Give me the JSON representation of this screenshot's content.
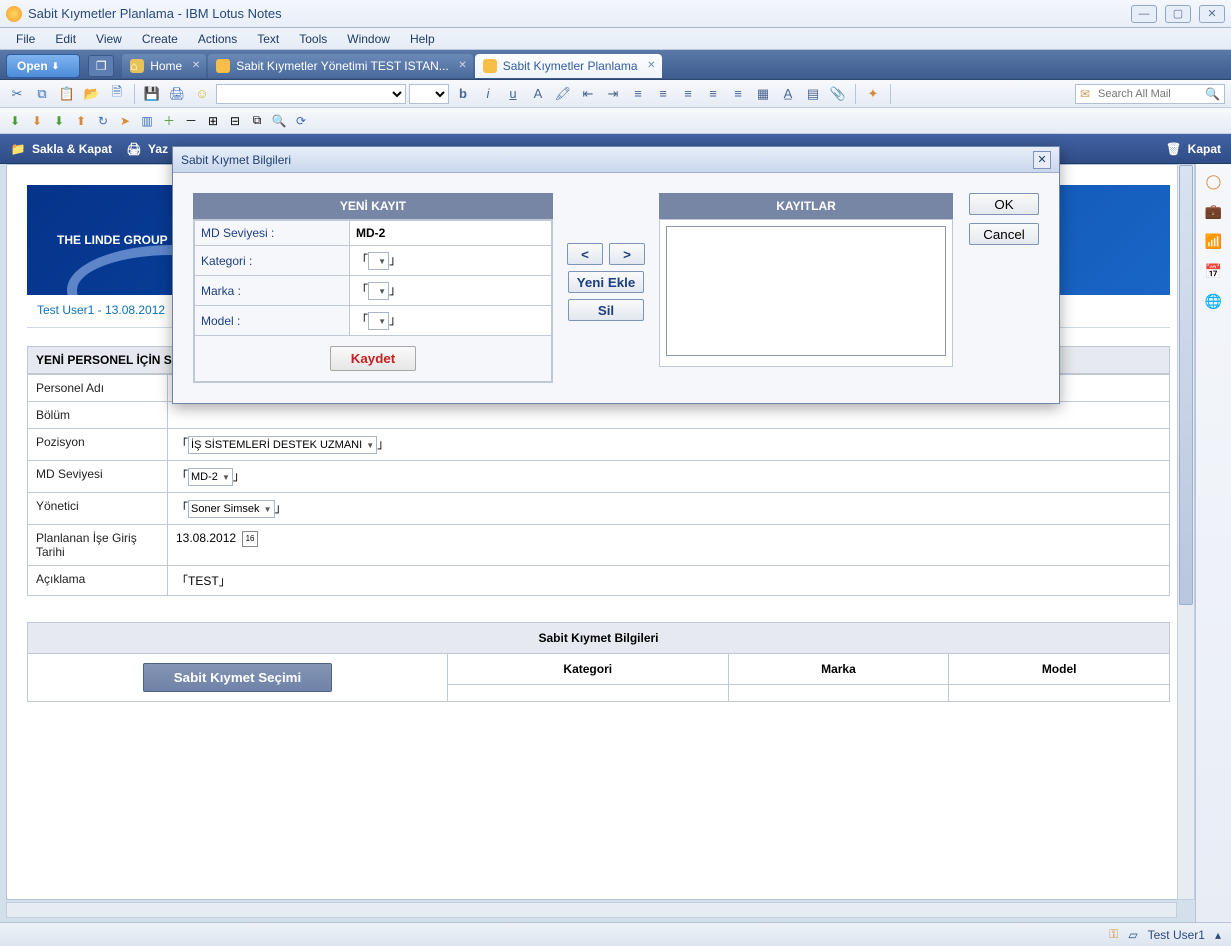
{
  "window": {
    "title": "Sabit Kıymetler Planlama - IBM Lotus Notes"
  },
  "menu": [
    "File",
    "Edit",
    "View",
    "Create",
    "Actions",
    "Text",
    "Tools",
    "Window",
    "Help"
  ],
  "open_button": "Open",
  "tabs": [
    {
      "label": "Home",
      "active": false
    },
    {
      "label": "Sabit Kıymetler Yönetimi TEST ISTAN...",
      "active": false
    },
    {
      "label": "Sabit Kıymetler Planlama",
      "active": true
    }
  ],
  "search_placeholder": "Search All Mail",
  "actions": {
    "save_close": "Sakla & Kapat",
    "print": "Yaz",
    "kapat": "Kapat"
  },
  "banner": {
    "company": "THE LINDE GROUP"
  },
  "info_line": "Test User1 - 13.08.2012",
  "form_section_title": "YENİ PERSONEL İÇİN SA",
  "form_rows": {
    "personel_adi": {
      "label": "Personel Adı",
      "value": ""
    },
    "bolum": {
      "label": "Bölüm",
      "value": ""
    },
    "pozisyon": {
      "label": "Pozisyon",
      "value": "İŞ SİSTEMLERİ DESTEK UZMANI"
    },
    "md_seviyesi": {
      "label": "MD Seviyesi",
      "value": "MD-2"
    },
    "yonetici": {
      "label": "Yönetici",
      "value": "Soner Simsek"
    },
    "planlanan": {
      "label": "Planlanan İşe Giriş Tarihi",
      "value": "13.08.2012"
    },
    "aciklama": {
      "label": "Açıklama",
      "value": "TEST"
    }
  },
  "sk_section_title": "Sabit Kıymet Bilgileri",
  "sk_button": "Sabit Kıymet Seçimi",
  "sk_columns": [
    "Kategori",
    "Marka",
    "Model"
  ],
  "dialog": {
    "title": "Sabit Kıymet Bilgileri",
    "left_header": "YENİ KAYIT",
    "right_header": "KAYITLAR",
    "rows": {
      "md": {
        "label": "MD Seviyesi :",
        "value": "MD-2"
      },
      "kategori": {
        "label": "Kategori :",
        "value": ""
      },
      "marka": {
        "label": "Marka :",
        "value": ""
      },
      "model": {
        "label": "Model :",
        "value": ""
      }
    },
    "kaydet": "Kaydet",
    "prev": "<",
    "next": ">",
    "yeni_ekle": "Yeni Ekle",
    "sil": "Sil",
    "ok": "OK",
    "cancel": "Cancel"
  },
  "status": {
    "user": "Test User1",
    "key_icon": "⚿",
    "net_icon": "▱"
  }
}
